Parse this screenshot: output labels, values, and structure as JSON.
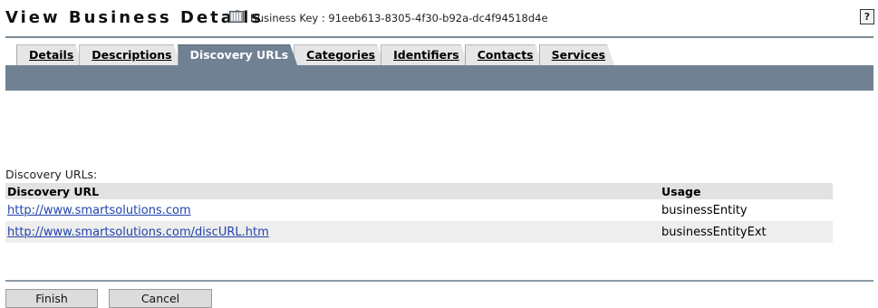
{
  "header": {
    "title": "View Business Details",
    "icon": "calendar-icon",
    "business_key": "Business Key : 91eeb613-8305-4f30-b92a-dc4f94518d4e",
    "help_label": "?"
  },
  "tabs": [
    {
      "label": "Details"
    },
    {
      "label": "Descriptions"
    },
    {
      "label": "Discovery URLs",
      "active": true
    },
    {
      "label": "Categories"
    },
    {
      "label": "Identifiers"
    },
    {
      "label": "Contacts"
    },
    {
      "label": "Services"
    }
  ],
  "colors": {
    "accent": "#6f8192",
    "link": "#2244aa"
  },
  "discovery": {
    "section_label": "Discovery URLs:",
    "columns": [
      "Discovery URL",
      "Usage"
    ],
    "rows": [
      {
        "url": "http://www.smartsolutions.com",
        "usage": "businessEntity"
      },
      {
        "url": "http://www.smartsolutions.com/discURL.htm",
        "usage": "businessEntityExt"
      }
    ]
  },
  "buttons": {
    "finish": "Finish",
    "cancel": "Cancel"
  }
}
